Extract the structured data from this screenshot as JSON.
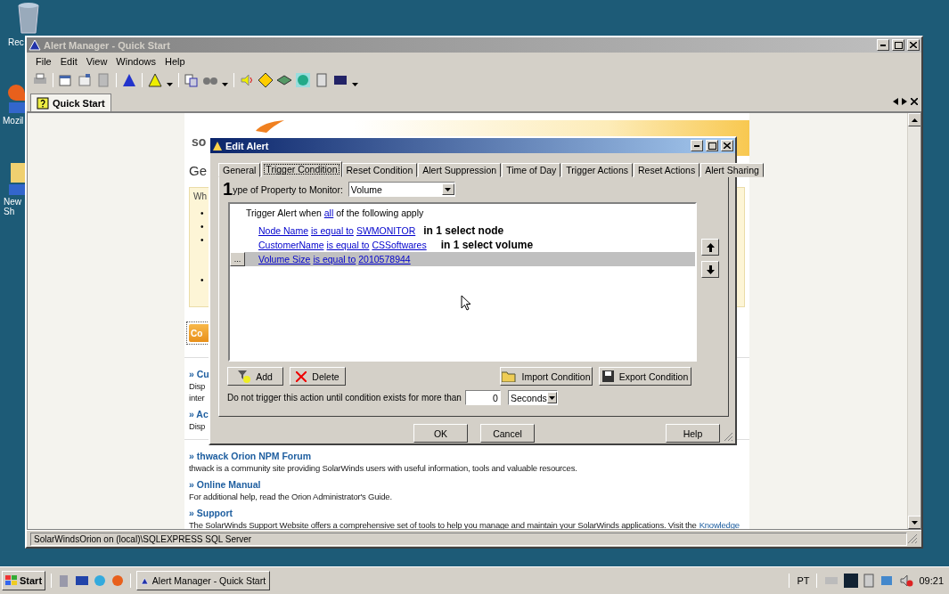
{
  "desktop_icons": [
    {
      "label": "Rec"
    },
    {
      "label": "Mozil"
    },
    {
      "label": "New Sh"
    }
  ],
  "main_window": {
    "title": "Alert Manager - Quick Start",
    "menu": [
      "File",
      "Edit",
      "View",
      "Windows",
      "Help"
    ],
    "doc_tabs": [
      {
        "label": "Quick Start",
        "selected": true
      }
    ],
    "page": {
      "logo": "so",
      "heading": "Ge",
      "intro": "Wh",
      "bullets": [
        "•",
        "•",
        "•",
        "•"
      ],
      "cta": "Co",
      "sections": [
        {
          "title": "» Cu",
          "lines": [
            "Disp",
            "inter"
          ]
        },
        {
          "title": "» Ac",
          "lines": [
            "Disp"
          ]
        },
        {
          "title": "» thwack Orion NPM Forum",
          "lines": [
            "thwack is a community site providing SolarWinds users with useful information, tools and valuable resources."
          ]
        },
        {
          "title": "» Online Manual",
          "lines": [
            "For additional help, read the Orion Administrator's Guide."
          ]
        },
        {
          "title": "» Support",
          "lines": [
            "The SolarWinds Support Website offers a comprehensive set of tools to help you manage and maintain your SolarWinds applications. Visit the"
          ],
          "link": "Knowledge"
        }
      ]
    },
    "status_bar": "SolarWindsOrion on (local)\\SQLEXPRESS SQL Server"
  },
  "dialog": {
    "title": "Edit Alert",
    "tabs": [
      {
        "label": "General",
        "selected": false
      },
      {
        "label": "Trigger Condition",
        "selected": true
      },
      {
        "label": "Reset Condition",
        "selected": false
      },
      {
        "label": "Alert Suppression",
        "selected": false
      },
      {
        "label": "Time of Day",
        "selected": false
      },
      {
        "label": "Trigger Actions",
        "selected": false
      },
      {
        "label": "Reset Actions",
        "selected": false
      },
      {
        "label": "Alert Sharing",
        "selected": false
      }
    ],
    "step_mark": "1",
    "property_label": "ype of Property to Monitor:",
    "property_value": "Volume",
    "condition_header": {
      "before": "Trigger Alert when",
      "link": "all",
      "after": "of the following apply"
    },
    "edit_button": "...",
    "conditions": [
      {
        "field": "Node Name",
        "operator": "is equal to",
        "value": "SWMONITOR",
        "note": "in 1 select node",
        "selected": false
      },
      {
        "field": "CustomerName",
        "operator": "is equal to",
        "value": "CSSoftwares",
        "note": "in 1 select volume",
        "selected": false
      },
      {
        "field": "Volume Size",
        "operator": "is equal to",
        "value": "2010578944",
        "selected": true
      }
    ],
    "add": "Add",
    "delete": "Delete",
    "import": "Import Condition",
    "export": "Export Condition",
    "delay": {
      "label": "Do not trigger this action until condition exists for more than",
      "value": "0",
      "unit": "Seconds"
    },
    "footer": [
      "OK",
      "Cancel",
      "Help"
    ]
  },
  "taskbar": {
    "start": "Start",
    "task": "Alert Manager - Quick Start",
    "language": "PT",
    "time": "09:21"
  }
}
